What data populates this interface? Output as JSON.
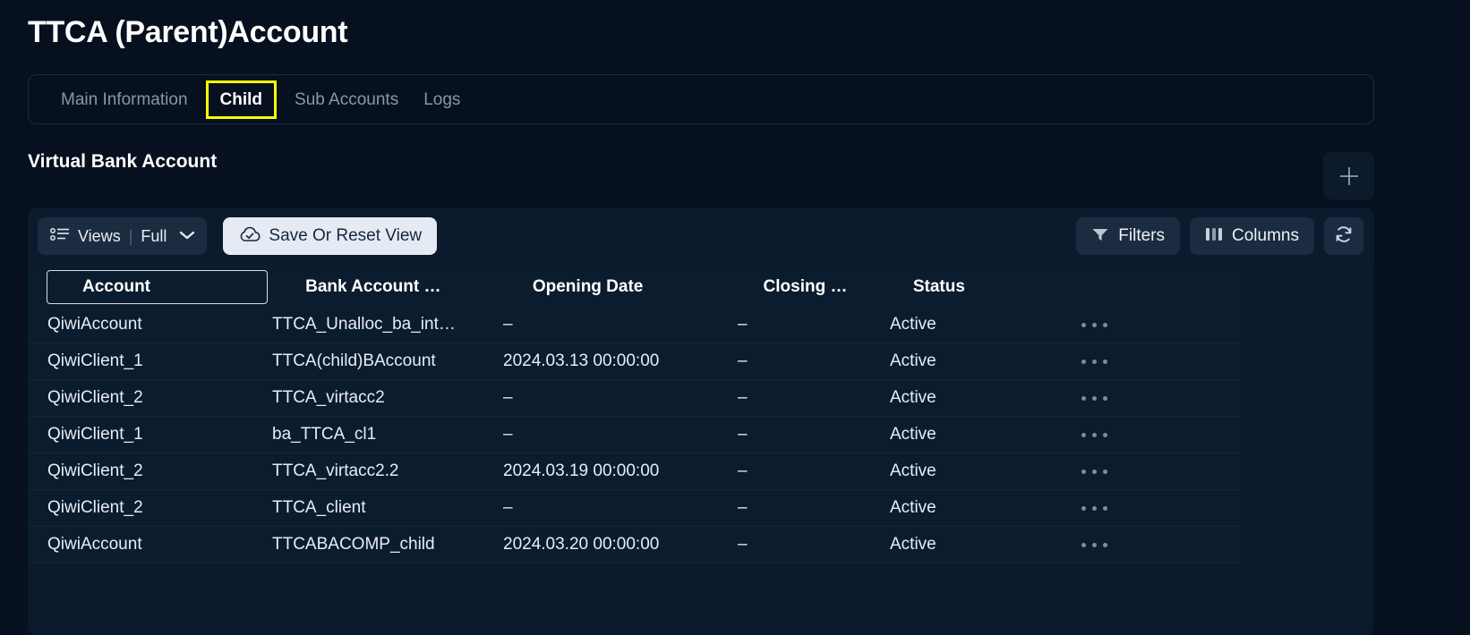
{
  "header": {
    "title": "TTCA (Parent)Account"
  },
  "tabs": [
    {
      "label": "Main Information",
      "active": false
    },
    {
      "label": "Child",
      "active": true
    },
    {
      "label": "Sub Accounts",
      "active": false
    },
    {
      "label": "Logs",
      "active": false
    }
  ],
  "section": {
    "title": "Virtual Bank Account"
  },
  "toolbar": {
    "views_label": "Views",
    "views_separator": "|",
    "views_value": "Full",
    "save_label": "Save Or Reset View",
    "filters_label": "Filters",
    "columns_label": "Columns",
    "add_icon": "plus-icon",
    "refresh_icon": "refresh-icon",
    "views_icon": "list-view-icon",
    "save_icon": "cloud-check-icon",
    "filters_icon": "funnel-icon",
    "columns_icon": "columns-icon"
  },
  "table": {
    "columns": [
      {
        "label": "Account",
        "selected": true
      },
      {
        "label": "Bank Account …",
        "selected": false
      },
      {
        "label": "Opening Date",
        "selected": false
      },
      {
        "label": "Closing …",
        "selected": false
      },
      {
        "label": "Status",
        "selected": false
      }
    ],
    "rows": [
      {
        "account": "QiwiAccount",
        "bank_account": "TTCA_Unalloc_ba_int…",
        "opening_date": "–",
        "closing_date": "–",
        "status": "Active"
      },
      {
        "account": "QiwiClient_1",
        "bank_account": "TTCA(child)BAccount",
        "opening_date": "2024.03.13 00:00:00",
        "closing_date": "–",
        "status": "Active"
      },
      {
        "account": "QiwiClient_2",
        "bank_account": "TTCA_virtacc2",
        "opening_date": "–",
        "closing_date": "–",
        "status": "Active"
      },
      {
        "account": "QiwiClient_1",
        "bank_account": "ba_TTCA_cl1",
        "opening_date": "–",
        "closing_date": "–",
        "status": "Active"
      },
      {
        "account": "QiwiClient_2",
        "bank_account": "TTCA_virtacc2.2",
        "opening_date": "2024.03.19 00:00:00",
        "closing_date": "–",
        "status": "Active"
      },
      {
        "account": "QiwiClient_2",
        "bank_account": "TTCA_client",
        "opening_date": "–",
        "closing_date": "–",
        "status": "Active"
      },
      {
        "account": "QiwiAccount",
        "bank_account": "TTCABACOMP_child",
        "opening_date": "2024.03.20 00:00:00",
        "closing_date": "–",
        "status": "Active"
      }
    ]
  },
  "colors": {
    "page_background": "#06101f",
    "table_background": "#0c1c2f",
    "accent_highlight": "#ffff00",
    "chip_background": "#1c2c40",
    "save_button_background": "#e6eaf3"
  }
}
